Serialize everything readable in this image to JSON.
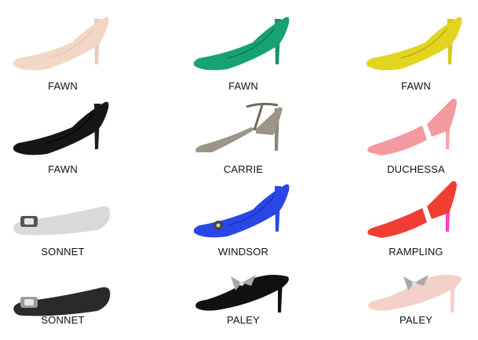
{
  "products": [
    {
      "name": "FAWN",
      "style": "pump",
      "color": "#f2d6c6",
      "accent": "#e7c3ae",
      "heel": "#ecc9b7"
    },
    {
      "name": "FAWN",
      "style": "pump",
      "color": "#16a274",
      "accent": "#0b6b4c",
      "heel": "#12946a"
    },
    {
      "name": "FAWN",
      "style": "pump",
      "color": "#e3d41f",
      "accent": "#b5a80f",
      "heel": "#d8c81a"
    },
    {
      "name": "FAWN",
      "style": "pump",
      "color": "#161616",
      "accent": "#000000",
      "heel": "#1c1c1c"
    },
    {
      "name": "CARRIE",
      "style": "tstrap",
      "color": "#9a9585",
      "accent": "#6f6a5d",
      "heel": "#8d877a"
    },
    {
      "name": "DUCHESSA",
      "style": "dorsay",
      "color": "#f39aa0",
      "accent": "#e77a82",
      "heel": "#f3a6ab"
    },
    {
      "name": "SONNET",
      "style": "flat",
      "color": "#d9d9d9",
      "accent": "#555555",
      "heel": "#e8e8e8"
    },
    {
      "name": "WINDSOR",
      "style": "bowpump",
      "color": "#2847e6",
      "accent": "#1a30b0",
      "heel": "#2a49e8"
    },
    {
      "name": "RAMPLING",
      "style": "dorsay",
      "color": "#f23d32",
      "accent": "#ff2fb0",
      "heel": "#ff3fc0"
    },
    {
      "name": "SONNET",
      "style": "flat",
      "color": "#2a2a2a",
      "accent": "#9a9a9a",
      "heel": "#2a2a2a"
    },
    {
      "name": "PALEY",
      "style": "mule",
      "color": "#111111",
      "accent": "#a8a8a8",
      "heel": "#111111"
    },
    {
      "name": "PALEY",
      "style": "mule",
      "color": "#f3d0c8",
      "accent": "#a8a8a8",
      "heel": "#f3d0c8"
    }
  ]
}
